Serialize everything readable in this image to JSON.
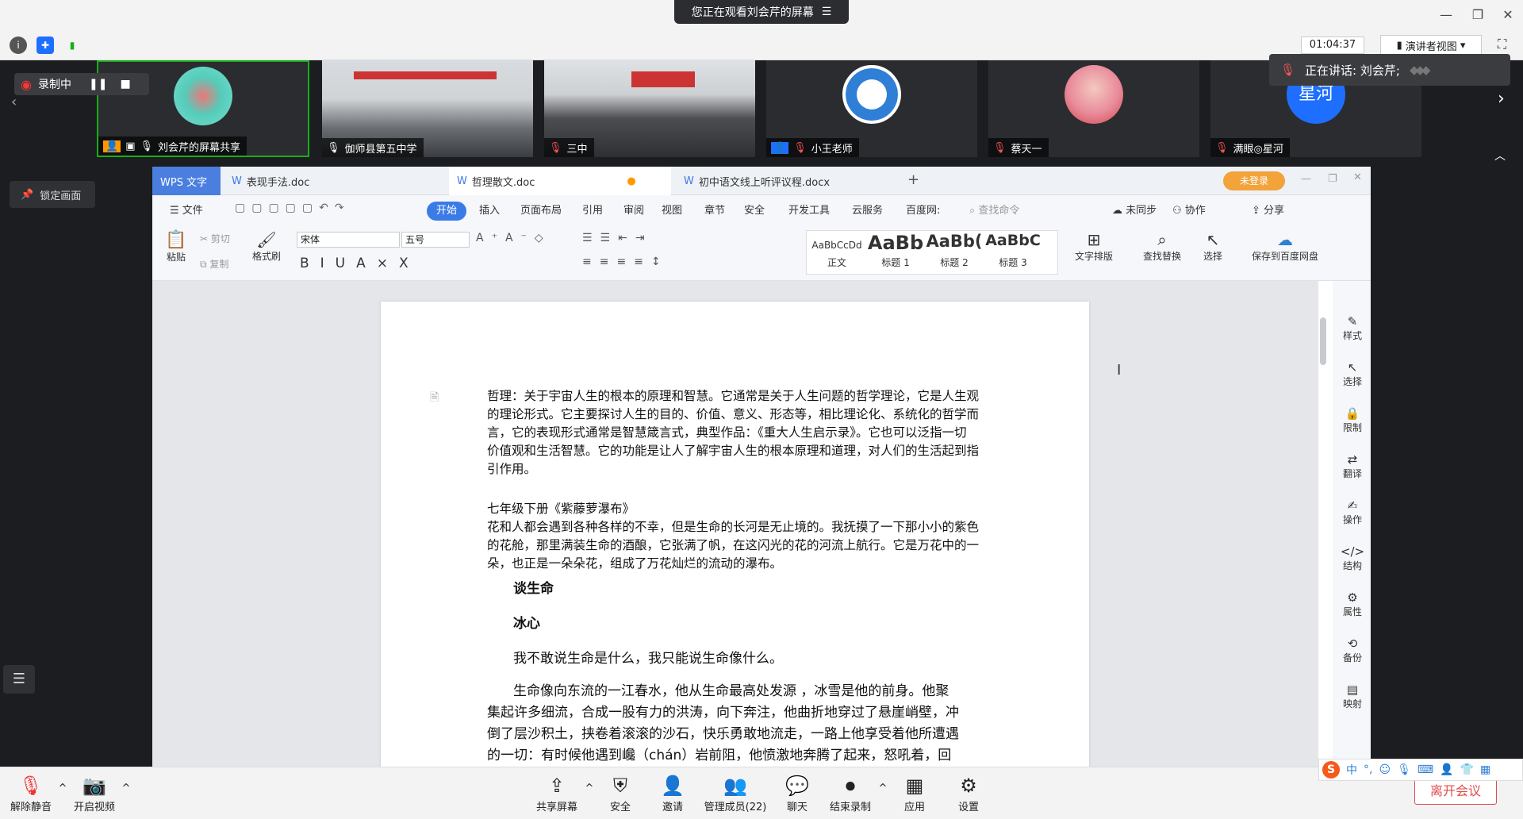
{
  "top": {
    "banner": "您正在观看刘会芹的屏幕",
    "timer": "01:04:37",
    "view_mode": "演讲者视图"
  },
  "recording": {
    "label": "录制中"
  },
  "speaking": {
    "text": "正在讲话: 刘会芹;"
  },
  "tiles": [
    {
      "label": "刘会芹的屏幕共享"
    },
    {
      "label": "伽师县第五中学"
    },
    {
      "label": "三中"
    },
    {
      "label": "小王老师"
    },
    {
      "label": "蔡天一"
    },
    {
      "label": "满眼◎星河",
      "avatar_text": "星河"
    }
  ],
  "lock_label": "锁定画面",
  "wps": {
    "app_tab": "WPS 文字",
    "tabs": [
      "表现手法.doc",
      "哲理散文.doc",
      "初中语文线上听评议程.docx"
    ],
    "login": "未登录",
    "menu_file": "文件",
    "menus": [
      "开始",
      "插入",
      "页面布局",
      "引用",
      "审阅",
      "视图",
      "章节",
      "安全",
      "开发工具",
      "云服务",
      "百度网:"
    ],
    "search": "查找命令",
    "right_actions": [
      "未同步",
      "协作",
      "分享"
    ],
    "font": "宋体",
    "size": "五号",
    "styles": [
      {
        "sample": "AaBbCcDd",
        "name": "正文"
      },
      {
        "sample": "AaBb",
        "name": "标题 1"
      },
      {
        "sample": "AaBb(",
        "name": "标题 2"
      },
      {
        "sample": "AaBbC",
        "name": "标题 3"
      }
    ],
    "ribbon_labels": {
      "paste": "粘贴",
      "cut": "剪切",
      "copy": "复制",
      "format_painter": "格式刷",
      "text_layout": "文字排版",
      "find_replace": "查找替换",
      "select": "选择",
      "save_baidu": "保存到百度网盘"
    },
    "sidebar": [
      "样式",
      "选择",
      "限制",
      "翻译",
      "操作",
      "结构",
      "属性",
      "备份",
      "映射"
    ]
  },
  "doc": {
    "p1": [
      "哲理：关于宇宙人生的根本的原理和智慧。它通常是关于人生问题的哲学理论，它是人生观",
      "的理论形式。它主要探讨人生的目的、价值、意义、形态等，相比理论化、系统化的哲学而",
      "言，它的表现形式通常是智慧箴言式，典型作品：《重大人生启示录》。它也可以泛指一切",
      "价值观和生活智慧。它的功能是让人了解宇宙人生的根本原理和道理，对人们的生活起到指",
      "引作用。"
    ],
    "p2_title": "七年级下册《紫藤萝瀑布》",
    "p2": [
      "花和人都会遇到各种各样的不幸，但是生命的长河是无止境的。我抚摸了一下那小小的紫色",
      "的花舱，那里满装生命的酒酿，它张满了帆，在这闪光的花的河流上航行。它是万花中的一",
      "朵，也正是一朵朵花，组成了万花灿烂的流动的瀑布。"
    ],
    "h1": "谈生命",
    "h2": "冰心",
    "p3": "我不敢说生命是什么，我只能说生命像什么。",
    "p4": [
      "生命像向东流的一江春水，他从生命最高处发源 ，冰雪是他的前身。他聚",
      "集起许多细流，合成一股有力的洪涛，向下奔注，他曲折地穿过了悬崖峭壁，冲",
      "倒了层沙积土，挟卷着滚滚的沙石，快乐勇敢地流走，一路上他享受着他所遭遇",
      "的一切：有时候他遇到巉（chán）岩前阻，他愤激地奔腾了起来，怒吼着，回"
    ]
  },
  "bottom": {
    "mute": "解除静音",
    "video": "开启视频",
    "share": "共享屏幕",
    "security": "安全",
    "invite": "邀请",
    "members": "管理成员(22)",
    "chat": "聊天",
    "end_rec": "结束录制",
    "apps": "应用",
    "settings": "设置",
    "leave": "离开会议",
    "ime": "中"
  }
}
